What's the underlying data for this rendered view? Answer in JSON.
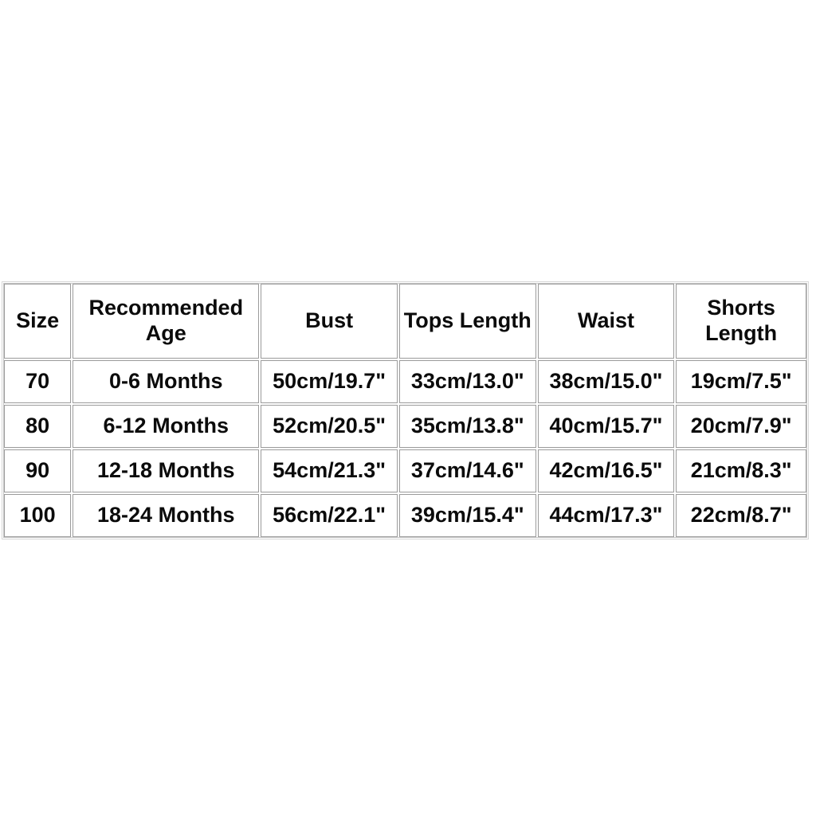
{
  "page": {
    "background_color": "#ffffff",
    "text_color": "#0b0b0b",
    "cell_border_color": "#9b9b9b",
    "frame_color": "#d8d8d8"
  },
  "table": {
    "headers": [
      "Size",
      "Recommended Age",
      "Bust",
      "Tops Length",
      "Waist",
      "Shorts Length"
    ],
    "rows": [
      {
        "size": "70",
        "age": "0-6 Months",
        "bust": "50cm/19.7\"",
        "tops_length": "33cm/13.0\"",
        "waist": "38cm/15.0\"",
        "shorts_length": "19cm/7.5\""
      },
      {
        "size": "80",
        "age": "6-12 Months",
        "bust": "52cm/20.5\"",
        "tops_length": "35cm/13.8\"",
        "waist": "40cm/15.7\"",
        "shorts_length": "20cm/7.9\""
      },
      {
        "size": "90",
        "age": "12-18 Months",
        "bust": "54cm/21.3\"",
        "tops_length": "37cm/14.6\"",
        "waist": "42cm/16.5\"",
        "shorts_length": "21cm/8.3\""
      },
      {
        "size": "100",
        "age": "18-24 Months",
        "bust": "56cm/22.1\"",
        "tops_length": "39cm/15.4\"",
        "waist": "44cm/17.3\"",
        "shorts_length": "22cm/8.7\""
      }
    ]
  }
}
